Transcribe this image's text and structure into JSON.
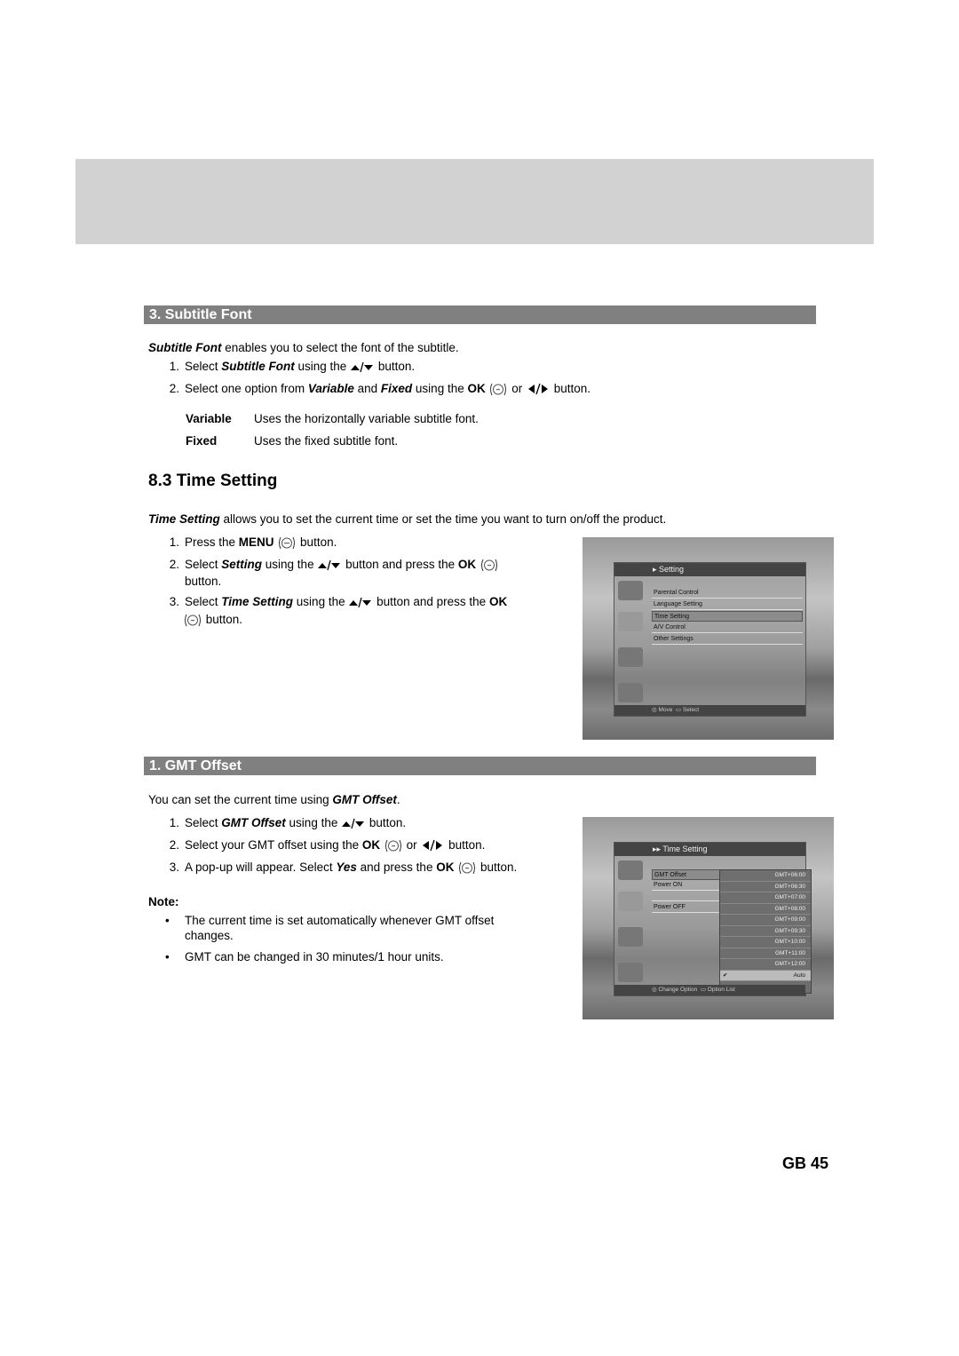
{
  "section_subtitle_font": {
    "bar_title": "3. Subtitle Font",
    "intro_term": "Subtitle Font",
    "intro_rest": " enables you to select the font of the subtitle.",
    "steps": [
      {
        "num": "1.",
        "pre": "Select ",
        "term": "Subtitle Font",
        "mid": " using the ",
        "post": " button."
      },
      {
        "num": "2.",
        "pre": "Select one option from ",
        "term1": "Variable",
        "and": " and ",
        "term2": "Fixed",
        "mid": " using the ",
        "ok": "OK",
        "or": " or ",
        "post": " button."
      }
    ],
    "options": [
      {
        "name": "Variable",
        "desc": "Uses the horizontally variable subtitle font."
      },
      {
        "name": "Fixed",
        "desc": "Uses the fixed subtitle font."
      }
    ]
  },
  "section_time_setting": {
    "heading": "8.3 Time Setting",
    "intro_term": "Time Setting",
    "intro_rest": " allows you to set the current time or set the time you want to turn on/off the product.",
    "steps": [
      {
        "num": "1.",
        "pre": "Press the ",
        "key": "MENU",
        "post": " button."
      },
      {
        "num": "2.",
        "pre": "Select ",
        "term": "Setting",
        "mid": " using the ",
        "mid2": " button and press the ",
        "key": "OK",
        "post": "button."
      },
      {
        "num": "3.",
        "pre": "Select ",
        "term": "Time Setting",
        "mid": " using the ",
        "mid2": " button and press the ",
        "key": "OK",
        "post": " button."
      }
    ],
    "screen": {
      "title": "Setting",
      "items": [
        "Parental Control",
        "Language Setting",
        "Time Setting",
        "A/V Control",
        "Other Settings"
      ],
      "selected_index": 2,
      "footer": [
        "Move",
        "Select"
      ]
    }
  },
  "section_gmt_offset": {
    "bar_title": "1. GMT Offset",
    "intro_pre": "You can set the current time using ",
    "intro_term": "GMT Offset",
    "intro_post": ".",
    "steps": [
      {
        "num": "1.",
        "pre": "Select ",
        "term": "GMT Offset",
        "mid": " using the ",
        "post": " button."
      },
      {
        "num": "2.",
        "pre": "Select your GMT offset using the ",
        "key": "OK",
        "or": " or ",
        "post": " button."
      },
      {
        "num": "3.",
        "pre": "A pop-up will appear. Select ",
        "term": "Yes",
        "mid": " and press the ",
        "key": "OK",
        "post": " button."
      }
    ],
    "note_label": "Note:",
    "notes": [
      "The current time is set automatically whenever GMT offset changes.",
      "GMT can be changed in 30 minutes/1 hour units."
    ],
    "screen": {
      "title": "Time Setting",
      "items": [
        "GMT Offset",
        "Power ON",
        "",
        "Power OFF"
      ],
      "options": [
        "GMT+06:00",
        "GMT+06:30",
        "GMT+07:00",
        "GMT+08:00",
        "GMT+09:00",
        "GMT+09:30",
        "GMT+10:00",
        "GMT+11:00",
        "GMT+12:00",
        "Auto"
      ],
      "selected_option": "Auto",
      "footer": [
        "Change Option",
        "Option List"
      ]
    }
  },
  "page_number": "GB 45"
}
